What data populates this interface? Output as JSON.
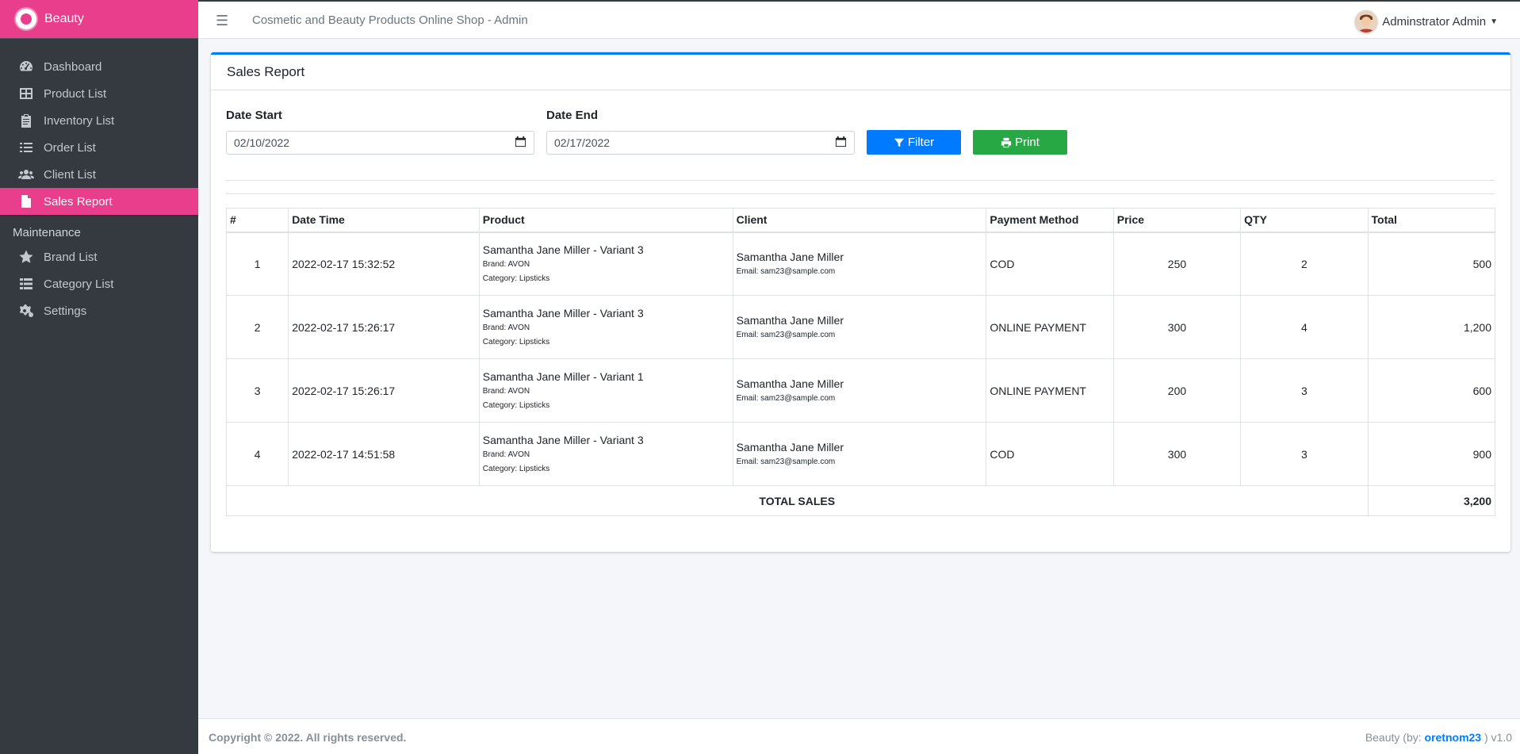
{
  "brand": {
    "name": "Beauty"
  },
  "sidebar": {
    "items": [
      {
        "label": "Dashboard",
        "icon": "dashboard-icon"
      },
      {
        "label": "Product List",
        "icon": "table-icon"
      },
      {
        "label": "Inventory List",
        "icon": "clipboard-icon"
      },
      {
        "label": "Order List",
        "icon": "list-icon"
      },
      {
        "label": "Client List",
        "icon": "users-icon"
      },
      {
        "label": "Sales Report",
        "icon": "file-icon",
        "active": true
      }
    ],
    "section_header": "Maintenance",
    "maintenance_items": [
      {
        "label": "Brand List",
        "icon": "star-icon"
      },
      {
        "label": "Category List",
        "icon": "th-list-icon"
      },
      {
        "label": "Settings",
        "icon": "cogs-icon"
      }
    ]
  },
  "topbar": {
    "title": "Cosmetic and Beauty Products Online Shop - Admin",
    "user": "Adminstrator Admin"
  },
  "card": {
    "title": "Sales Report",
    "date_start_label": "Date Start",
    "date_start_value": "02/10/2022",
    "date_end_label": "Date End",
    "date_end_value": "02/17/2022",
    "filter_label": "Filter",
    "print_label": "Print"
  },
  "table": {
    "headers": [
      "#",
      "Date Time",
      "Product",
      "Client",
      "Payment Method",
      "Price",
      "QTY",
      "Total"
    ],
    "rows": [
      {
        "num": "1",
        "datetime": "2022-02-17 15:32:52",
        "product": "Samantha Jane Miller - Variant 3",
        "brand": "Brand: AVON",
        "category": "Category: Lipsticks",
        "client": "Samantha Jane Miller",
        "email": "Email: sam23@sample.com",
        "payment": "COD",
        "price": "250",
        "qty": "2",
        "total": "500"
      },
      {
        "num": "2",
        "datetime": "2022-02-17 15:26:17",
        "product": "Samantha Jane Miller - Variant 3",
        "brand": "Brand: AVON",
        "category": "Category: Lipsticks",
        "client": "Samantha Jane Miller",
        "email": "Email: sam23@sample.com",
        "payment": "ONLINE PAYMENT",
        "price": "300",
        "qty": "4",
        "total": "1,200"
      },
      {
        "num": "3",
        "datetime": "2022-02-17 15:26:17",
        "product": "Samantha Jane Miller - Variant 1",
        "brand": "Brand: AVON",
        "category": "Category: Lipsticks",
        "client": "Samantha Jane Miller",
        "email": "Email: sam23@sample.com",
        "payment": "ONLINE PAYMENT",
        "price": "200",
        "qty": "3",
        "total": "600"
      },
      {
        "num": "4",
        "datetime": "2022-02-17 14:51:58",
        "product": "Samantha Jane Miller - Variant 3",
        "brand": "Brand: AVON",
        "category": "Category: Lipsticks",
        "client": "Samantha Jane Miller",
        "email": "Email: sam23@sample.com",
        "payment": "COD",
        "price": "300",
        "qty": "3",
        "total": "900"
      }
    ],
    "total_label": "TOTAL SALES",
    "total_value": "3,200"
  },
  "footer": {
    "copyright": "Copyright © 2022. All rights reserved.",
    "credit_prefix": "Beauty (by: ",
    "credit_author": "oretnom23",
    "credit_suffix": " ) v1.0"
  },
  "colors": {
    "accent": "#e83e8c",
    "sidebar": "#343a40",
    "primary": "#007bff",
    "success": "#28a745"
  }
}
